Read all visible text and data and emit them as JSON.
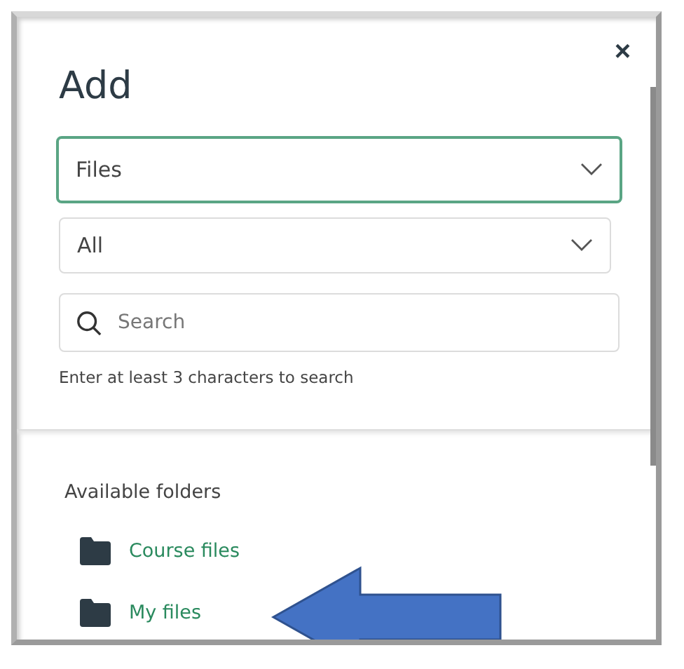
{
  "dialog": {
    "title": "Add",
    "close": "×"
  },
  "selects": [
    {
      "value": "Files",
      "focused": true
    },
    {
      "value": "All",
      "focused": false
    }
  ],
  "search": {
    "placeholder": "Search",
    "hint": "Enter at least 3 characters to search"
  },
  "folders": {
    "heading": "Available folders",
    "items": [
      {
        "label": "Course files"
      },
      {
        "label": "My files"
      }
    ]
  }
}
